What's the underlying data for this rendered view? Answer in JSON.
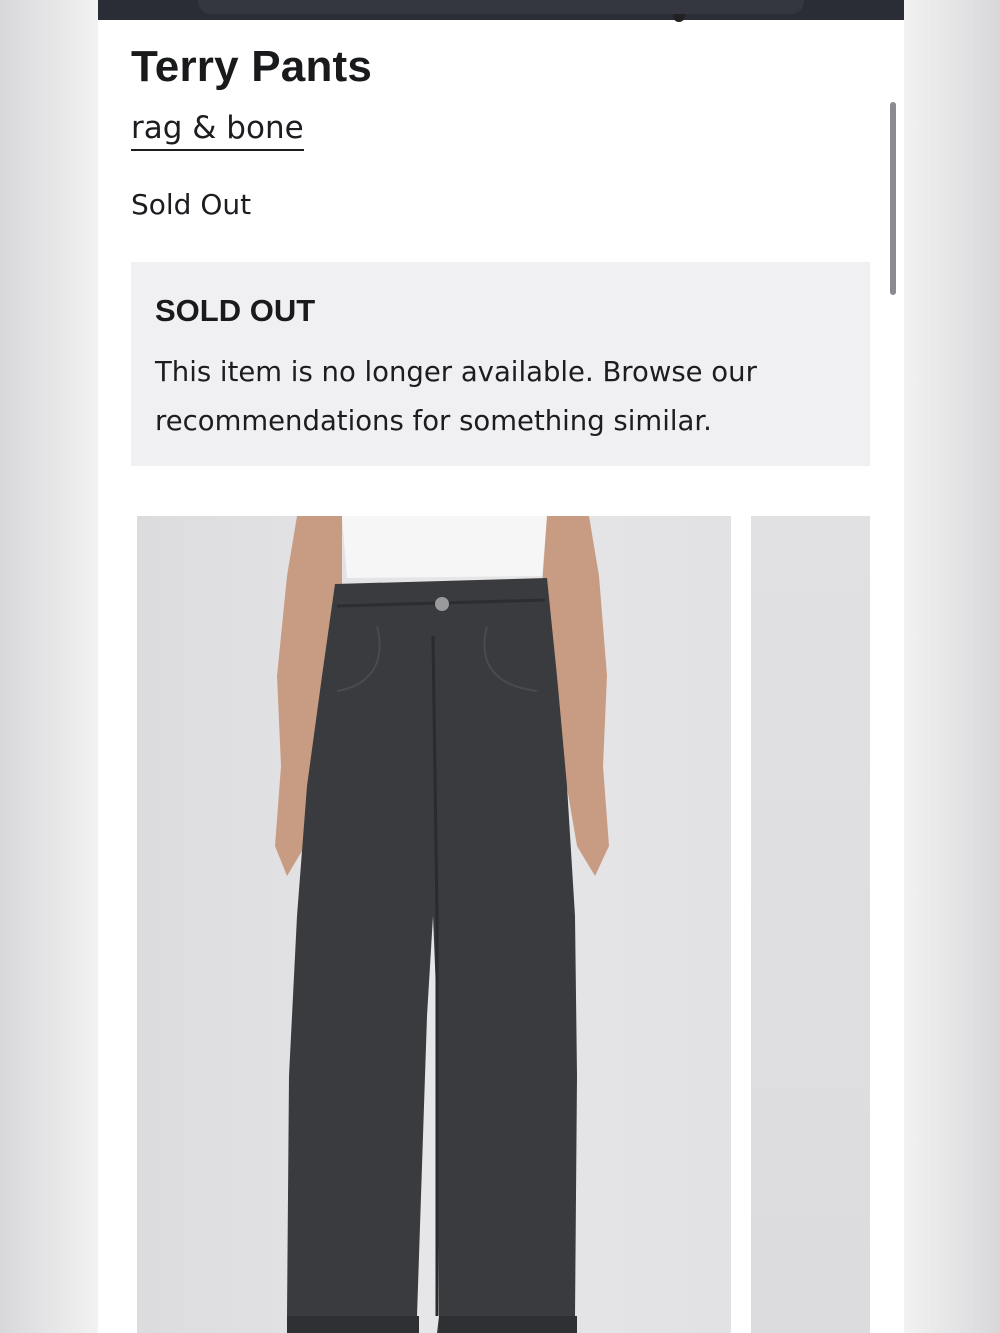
{
  "product": {
    "title": "Terry Pants",
    "brand": "rag & bone",
    "availability": "Sold Out"
  },
  "notice": {
    "heading": "SOLD OUT",
    "message": "This item is no longer available. Browse our recommendations for something similar."
  },
  "gallery": {
    "images": [
      {
        "subject": "black wide-leg cropped jeans worn with white top"
      },
      {
        "subject": "next product image (partially visible)"
      }
    ]
  },
  "colors": {
    "top_bar": "#2a2d35",
    "notice_bg": "#f0f0f2",
    "text": "#1c1d20",
    "denim": "#3a3b3e"
  }
}
